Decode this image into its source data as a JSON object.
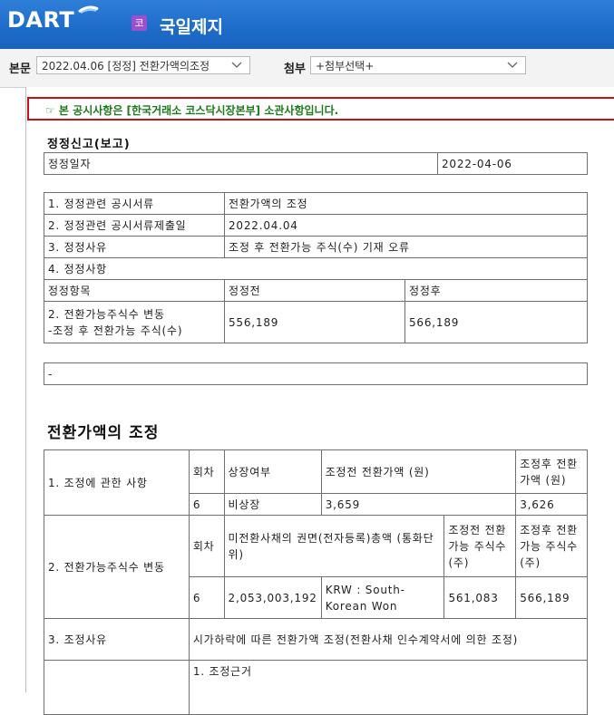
{
  "header": {
    "logo": "DART",
    "badge": "코",
    "company": "국일제지"
  },
  "nav": {
    "doc_label": "본문",
    "doc_select": "2022.04.06 [정정] 전환가액의조정",
    "attach_label": "첨부",
    "attach_select": "+첨부선택+"
  },
  "notice": "☞ 본 공시사항은 [한국거래소 코스닥시장본부] 소관사항입니다.",
  "correction": {
    "title": "정정신고(보고)",
    "date_label": "정정일자",
    "date_value": "2022-04-06",
    "rows": [
      {
        "label": "1. 정정관련 공시서류",
        "value": "전환가액의 조정"
      },
      {
        "label": "2. 정정관련 공시서류제출일",
        "value": "2022.04.04"
      },
      {
        "label": "3. 정정사유",
        "value": "조정 후 전환가능 주식(수) 기재 오류"
      }
    ],
    "section4": "4. 정정사항",
    "col_item": "정정항목",
    "col_before": "정정전",
    "col_after": "정정후",
    "item_line1": "2. 전환가능주식수 변동",
    "item_line2": "-조정 후 전환가능 주식(수)",
    "before": "556,189",
    "after": "566,189",
    "remark": "-"
  },
  "adjust": {
    "title": "전환가액의 조정",
    "sec1_label": "1. 조정에 관한 사항",
    "sec1_headers": [
      "회차",
      "상장여부",
      "조정전 전환가액 (원)",
      "조정후 전환가액 (원)"
    ],
    "sec1_values": [
      "6",
      "비상장",
      "3,659",
      "3,626"
    ],
    "sec2_label": "2. 전환가능주식수 변동",
    "sec2_headers": [
      "회차",
      "미전환사채의 권면(전자등록)총액 (통화단위)",
      "조정전 전환가능 주식수 (주)",
      "조정후 전환가능 주식수 (주)"
    ],
    "sec2_values": [
      "6",
      "2,053,003,192",
      "KRW : South-Korean Won",
      "561,083",
      "566,189"
    ],
    "sec3_label": "3. 조정사유",
    "sec3_value": "시가하락에 따른 전환가액 조정(전환사채 인수계약서에 의한 조정)",
    "sec4_value": "1. 조정근거"
  }
}
